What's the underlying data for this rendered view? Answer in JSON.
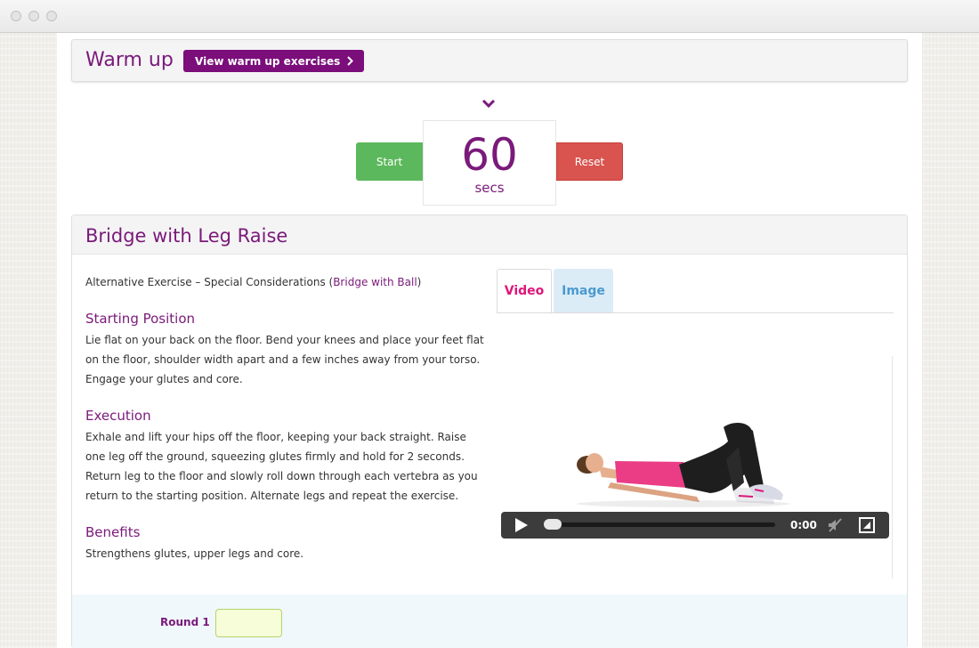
{
  "warmup": {
    "title": "Warm up",
    "button_label": "View warm up exercises"
  },
  "timer": {
    "value": "60",
    "unit": "secs",
    "start_label": "Start",
    "reset_label": "Reset"
  },
  "exercise": {
    "title": "Bridge with Leg Raise",
    "alt_prefix": "Alternative Exercise – Special Considerations (",
    "alt_link": "Bridge with Ball",
    "alt_suffix": ")",
    "starting_position": {
      "heading": "Starting Position",
      "text": "Lie flat on your back on the floor. Bend your knees and place your feet flat on the floor, shoulder width apart and a few inches away from your torso. Engage your glutes and core."
    },
    "execution": {
      "heading": "Execution",
      "text": "Exhale and lift your hips off the floor, keeping your back straight. Raise one leg off the ground, squeezing glutes firmly and hold for 2 seconds. Return leg to the floor and slowly roll down through each vertebra as you return to the starting position. Alternate legs and repeat the exercise."
    },
    "benefits": {
      "heading": "Benefits",
      "text": "Strengthens glutes, upper legs and core."
    }
  },
  "media_tabs": {
    "video_label": "Video",
    "image_label": "Image"
  },
  "video": {
    "time": "0:00",
    "progress": 0
  },
  "rounds": {
    "round1_label": "Round 1",
    "round1_value": ""
  },
  "colors": {
    "brand_purple": "#7a1a7a",
    "start_green": "#5cb85c",
    "reset_red": "#d9534f",
    "video_tab_pink": "#e0157a",
    "image_tab_blue": "#4a9ad0"
  }
}
